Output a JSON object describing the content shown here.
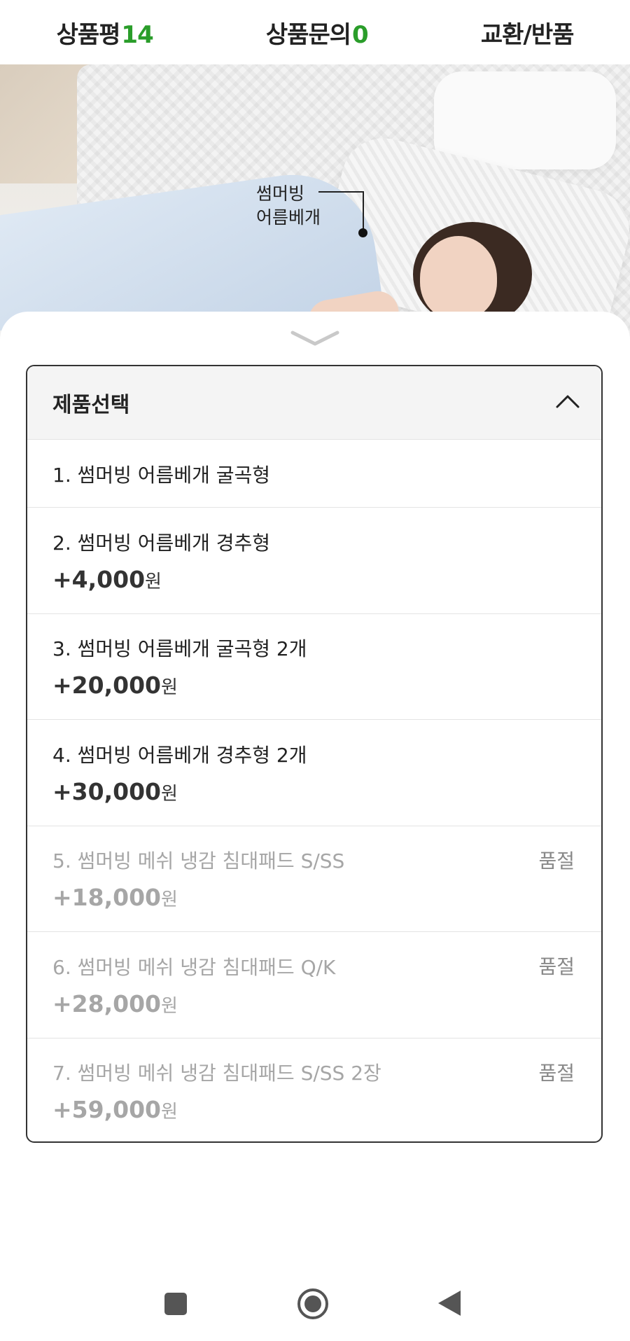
{
  "tabs": [
    {
      "label": "상품평",
      "count": "14"
    },
    {
      "label": "상품문의",
      "count": "0"
    },
    {
      "label": "교환/반품",
      "count": ""
    }
  ],
  "hero": {
    "callout_line1": "썸머빙",
    "callout_line2": "어름베개"
  },
  "selector": {
    "title": "제품선택",
    "options": [
      {
        "name": "1. 썸머빙 어름베개 굴곡형",
        "price": "",
        "won": "",
        "badge": ""
      },
      {
        "name": "2. 썸머빙 어름베개 경추형",
        "price": "+4,000",
        "won": "원",
        "badge": ""
      },
      {
        "name": "3. 썸머빙 어름베개 굴곡형 2개",
        "price": "+20,000",
        "won": "원",
        "badge": ""
      },
      {
        "name": "4. 썸머빙 어름베개 경추형 2개",
        "price": "+30,000",
        "won": "원",
        "badge": ""
      },
      {
        "name": "5. 썸머빙 메쉬 냉감 침대패드 S/SS",
        "price": "+18,000",
        "won": "원",
        "badge": "품절"
      },
      {
        "name": "6. 썸머빙 메쉬 냉감 침대패드 Q/K",
        "price": "+28,000",
        "won": "원",
        "badge": "품절"
      },
      {
        "name": "7. 썸머빙 메쉬 냉감 침대패드 S/SS 2장",
        "price": "+59,000",
        "won": "원",
        "badge": "품절"
      }
    ]
  },
  "colors": {
    "count_accent": "#2a9d2a",
    "soldout_text": "#a6a6a6"
  },
  "icons": [
    "chevron-down-icon",
    "chevron-up-icon",
    "recent-apps-icon",
    "home-icon",
    "back-icon"
  ]
}
